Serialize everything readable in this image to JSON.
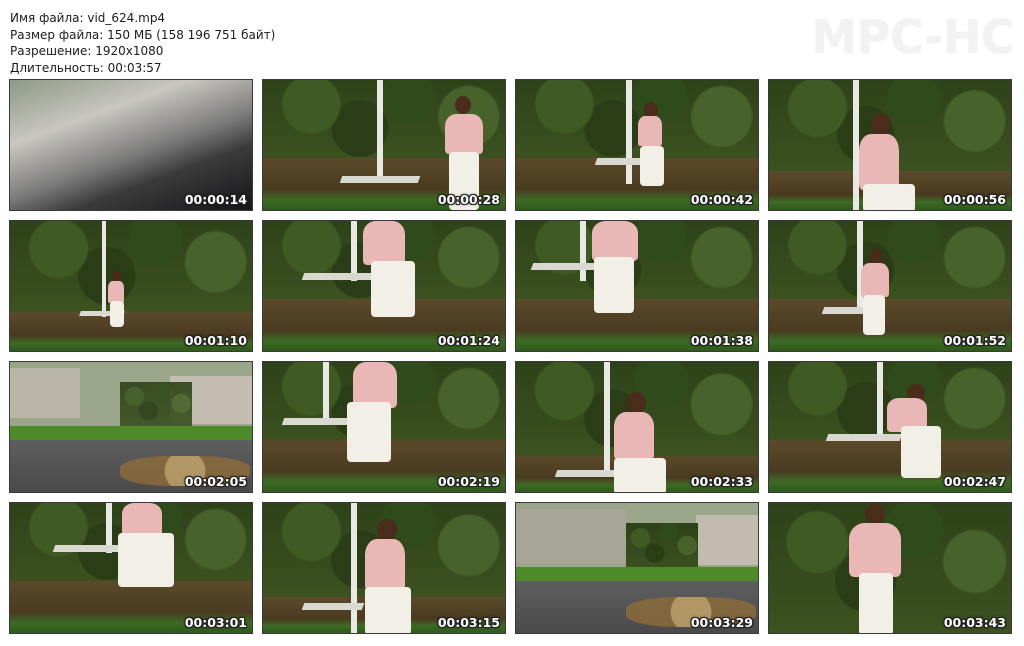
{
  "info": {
    "filename": "Имя файла: vid_624.mp4",
    "filesize": "Размер файла: 150 МБ (158 196 751 байт)",
    "resolution": "Разрешение: 1920x1080",
    "duration": "Длительность: 00:03:57"
  },
  "logo": "MPC-HC",
  "thumbnails": [
    {
      "time": "00:00:14"
    },
    {
      "time": "00:00:28"
    },
    {
      "time": "00:00:42"
    },
    {
      "time": "00:00:56"
    },
    {
      "time": "00:01:10"
    },
    {
      "time": "00:01:24"
    },
    {
      "time": "00:01:38"
    },
    {
      "time": "00:01:52"
    },
    {
      "time": "00:02:05"
    },
    {
      "time": "00:02:19"
    },
    {
      "time": "00:02:33"
    },
    {
      "time": "00:02:47"
    },
    {
      "time": "00:03:01"
    },
    {
      "time": "00:03:15"
    },
    {
      "time": "00:03:29"
    },
    {
      "time": "00:03:43"
    }
  ],
  "colors": {
    "logo": "#f2f2f2",
    "timestamp": "#ffffff",
    "foliage": "#2e4219",
    "shirt": "#e8b7b6",
    "pants": "#f1efe6"
  }
}
